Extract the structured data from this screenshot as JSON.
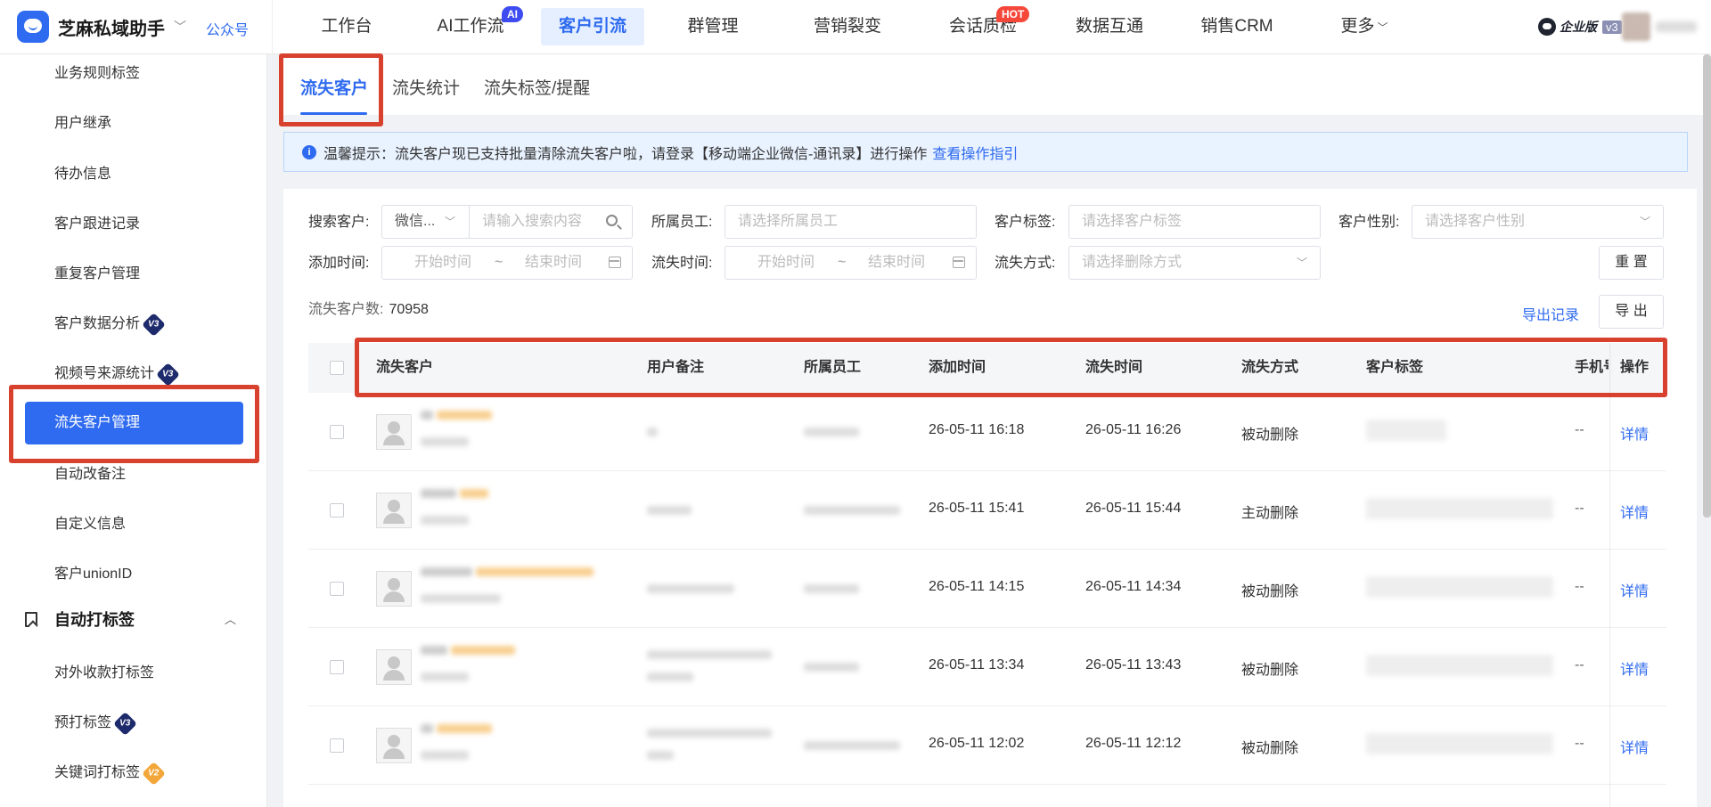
{
  "brand": {
    "name": "芝麻私域助手",
    "mp_label": "公众号"
  },
  "topnav": {
    "items": [
      {
        "label": "工作台"
      },
      {
        "label": "AI工作流",
        "badge": "AI"
      },
      {
        "label": "客户引流"
      },
      {
        "label": "群管理"
      },
      {
        "label": "营销裂变"
      },
      {
        "label": "会话质检",
        "badge": "HOT"
      },
      {
        "label": "数据互通"
      },
      {
        "label": "销售CRM"
      },
      {
        "label": "更多"
      }
    ],
    "active": "客户引流",
    "edition": "企业版",
    "edition_version": "v3"
  },
  "sidebar": {
    "items": [
      {
        "label": "业务规则标签"
      },
      {
        "label": "用户继承"
      },
      {
        "label": "待办信息"
      },
      {
        "label": "客户跟进记录"
      },
      {
        "label": "重复客户管理"
      },
      {
        "label": "客户数据分析",
        "badge": "V3"
      },
      {
        "label": "视频号来源统计",
        "badge": "V3"
      },
      {
        "label": "流失客户管理"
      },
      {
        "label": "自动改备注"
      },
      {
        "label": "自定义信息"
      },
      {
        "label": "客户unionID"
      }
    ],
    "active": "流失客户管理",
    "section": {
      "label": "自动打标签"
    },
    "section_items": [
      {
        "label": "对外收款打标签"
      },
      {
        "label": "预打标签",
        "badge": "V3"
      },
      {
        "label": "关键词打标签",
        "badge": "V2"
      }
    ]
  },
  "tabs": [
    {
      "label": "流失客户"
    },
    {
      "label": "流失统计"
    },
    {
      "label": "流失标签/提醒"
    }
  ],
  "notice": {
    "text": "温馨提示：流失客户现已支持批量清除流失客户啦，请登录【移动端企业微信-通讯录】进行操作",
    "link": "查看操作指引"
  },
  "filters": {
    "search_label": "搜索客户:",
    "search_type": "微信...",
    "search_placeholder": "请输入搜索内容",
    "staff_label": "所属员工:",
    "staff_placeholder": "请选择所属员工",
    "tag_label": "客户标签:",
    "tag_placeholder": "请选择客户标签",
    "gender_label": "客户性别:",
    "gender_placeholder": "请选择客户性别",
    "add_time_label": "添加时间:",
    "lost_time_label": "流失时间:",
    "start_placeholder": "开始时间",
    "end_placeholder": "结束时间",
    "range_sep": "~",
    "lost_way_label": "流失方式:",
    "lost_way_placeholder": "请选择删除方式",
    "reset_button": "重 置",
    "export_button": "导 出",
    "export_record": "导出记录"
  },
  "summary": {
    "label": "流失客户数:",
    "count": "70958"
  },
  "table": {
    "columns": [
      "流失客户",
      "用户备注",
      "所属员工",
      "添加时间",
      "流失时间",
      "流失方式",
      "客户标签",
      "手机号",
      "操作"
    ],
    "rows": [
      {
        "add_time": "26-05-11 16:18",
        "lost_time": "26-05-11 16:26",
        "lost_way": "被动删除",
        "phone": "--",
        "action": "详情"
      },
      {
        "add_time": "26-05-11 15:41",
        "lost_time": "26-05-11 15:44",
        "lost_way": "主动删除",
        "phone": "--",
        "action": "详情"
      },
      {
        "add_time": "26-05-11 14:15",
        "lost_time": "26-05-11 14:34",
        "lost_way": "被动删除",
        "phone": "--",
        "action": "详情"
      },
      {
        "add_time": "26-05-11 13:34",
        "lost_time": "26-05-11 13:43",
        "lost_way": "被动删除",
        "phone": "--",
        "action": "详情"
      },
      {
        "add_time": "26-05-11 12:02",
        "lost_time": "26-05-11 12:12",
        "lost_way": "被动删除",
        "phone": "--",
        "action": "详情"
      }
    ]
  },
  "colors": {
    "accent": "#2f6bf0",
    "highlight": "#d7412e",
    "nickname": "#f5a623"
  }
}
